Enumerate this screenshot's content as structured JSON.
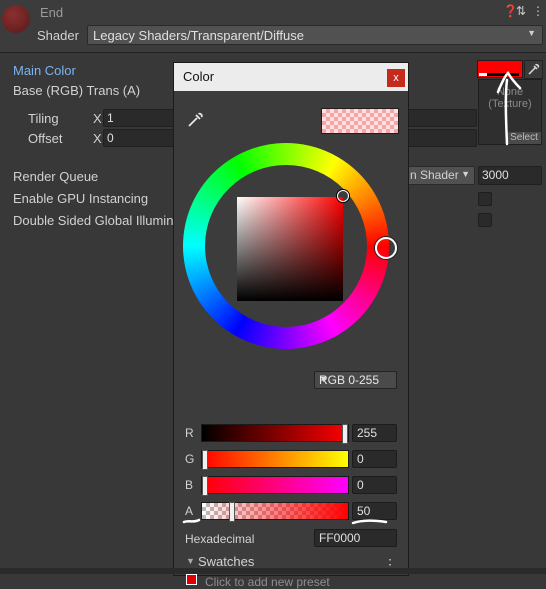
{
  "header": {
    "material_name": "End",
    "shader_label": "Shader",
    "shader_value": "Legacy Shaders/Transparent/Diffuse",
    "icons": [
      "help-icon",
      "presets-icon",
      "more-icon"
    ]
  },
  "inspector": {
    "main_color": "Main Color",
    "base_rgb": "Base (RGB) Trans (A)",
    "tiling": "Tiling",
    "offset": "Offset",
    "tiling_x_axis": "X",
    "tiling_x": "1",
    "offset_x_axis": "X",
    "offset_x": "0",
    "render_queue": "Render Queue",
    "render_queue_source": "n Shader",
    "render_queue_value": "3000",
    "gpu_instancing": "Enable GPU Instancing",
    "double_sided": "Double Sided Global Illumina",
    "texture_none": "None\n(Texture)",
    "texture_select": "Select"
  },
  "dialog": {
    "title": "Color",
    "close": "x",
    "mode": "RGB 0-255",
    "channels": [
      {
        "label": "R",
        "value": "255",
        "level": 1.0
      },
      {
        "label": "G",
        "value": "0",
        "level": 0.0
      },
      {
        "label": "B",
        "value": "0",
        "level": 0.0
      },
      {
        "label": "A",
        "value": "50",
        "level": 0.196
      }
    ],
    "hex_label": "Hexadecimal",
    "hex_value": "FF0000",
    "swatches_title": "Swatches",
    "swatches_hint": "Click to add new preset"
  },
  "colors": {
    "current": "#ff0000",
    "accent_label": "#7cb3f0"
  }
}
